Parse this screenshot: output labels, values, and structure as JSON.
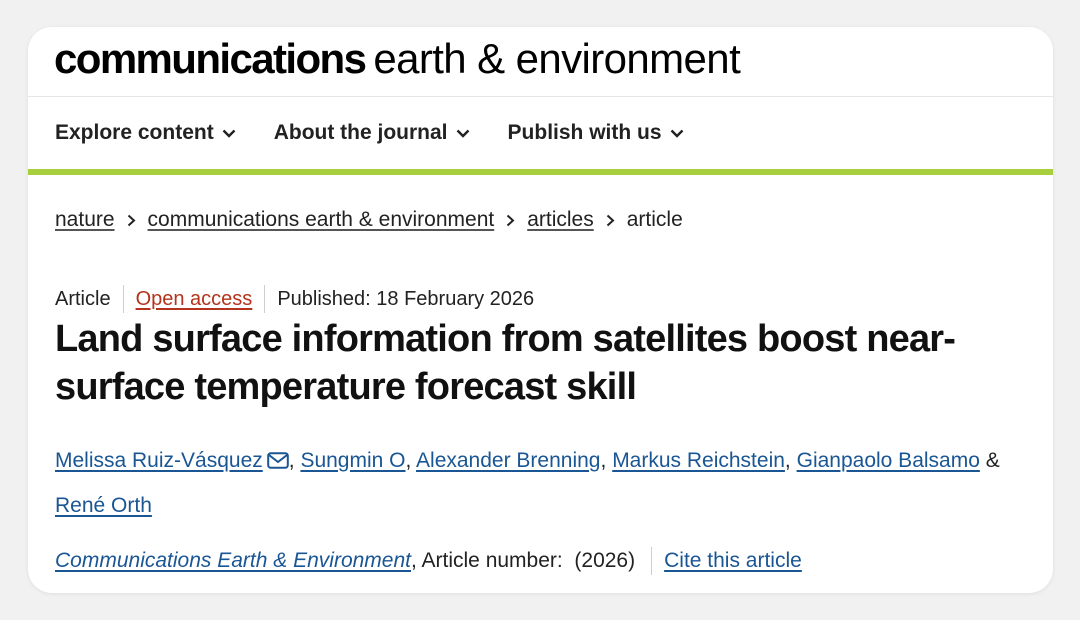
{
  "masthead": {
    "bold": "communications",
    "light": "earth & environment"
  },
  "nav": {
    "items": [
      {
        "label": "Explore content",
        "icon": "chevron-down-icon"
      },
      {
        "label": "About the journal",
        "icon": "chevron-down-icon"
      },
      {
        "label": "Publish with us",
        "icon": "chevron-down-icon"
      }
    ]
  },
  "breadcrumb": {
    "items": [
      "nature",
      "communications earth & environment",
      "articles",
      "article"
    ]
  },
  "meta": {
    "type": "Article",
    "access": "Open access",
    "published": "Published: 18 February 2026"
  },
  "title": "Land surface information from satellites boost near-surface temperature forecast skill",
  "authors": {
    "list": [
      "Melissa Ruiz-Vásquez",
      "Sungmin O",
      "Alexander Brenning",
      "Markus Reichstein",
      "Gianpaolo Balsamo",
      "René Orth"
    ],
    "separator": ",",
    "conjunction": "&"
  },
  "citation": {
    "journal": "Communications Earth & Environment",
    "article_number": ", Article number:  (2026)",
    "cite_link": "Cite this article"
  },
  "colors": {
    "accent_green": "#a8cf3d",
    "link_blue": "#1a5694",
    "open_access_red": "#b3331c"
  }
}
